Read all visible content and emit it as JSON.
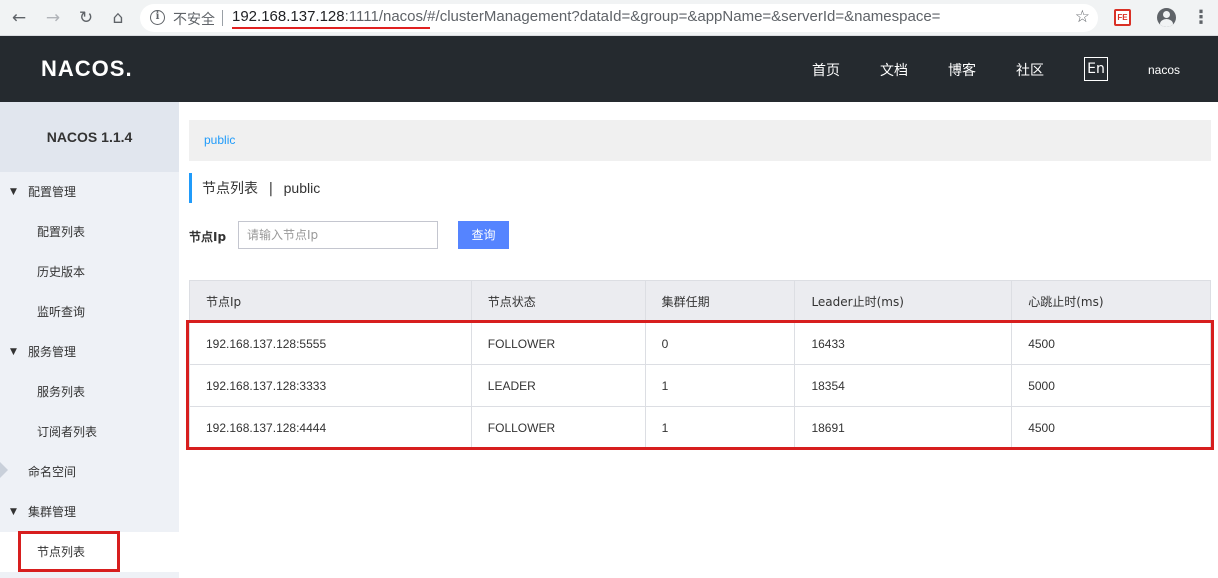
{
  "browser": {
    "insecure_label": "不安全",
    "url_host": "192.168.137.128",
    "url_rest": ":1111/nacos/#/clusterManagement?dataId=&group=&appName=&serverId=&namespace=",
    "ext_label": "FE"
  },
  "header": {
    "logo": "NACOS.",
    "nav": [
      "首页",
      "文档",
      "博客",
      "社区"
    ],
    "lang": "En",
    "user": "nacos"
  },
  "sidebar": {
    "version": "NACOS 1.1.4",
    "groups": [
      {
        "label": "配置管理",
        "items": [
          "配置列表",
          "历史版本",
          "监听查询"
        ]
      },
      {
        "label": "服务管理",
        "items": [
          "服务列表",
          "订阅者列表"
        ]
      },
      {
        "label": "命名空间"
      },
      {
        "label": "集群管理",
        "items": [
          "节点列表"
        ]
      }
    ]
  },
  "main": {
    "breadcrumb": "public",
    "title": "节点列表",
    "title_sep": "|",
    "namespace": "public",
    "filter_label": "节点Ip",
    "filter_placeholder": "请输入节点Ip",
    "query_label": "查询",
    "table": {
      "headers": [
        "节点Ip",
        "节点状态",
        "集群任期",
        "Leader止时(ms)",
        "心跳止时(ms)"
      ],
      "rows": [
        [
          "192.168.137.128:5555",
          "FOLLOWER",
          "0",
          "16433",
          "4500"
        ],
        [
          "192.168.137.128:3333",
          "LEADER",
          "1",
          "18354",
          "5000"
        ],
        [
          "192.168.137.128:4444",
          "FOLLOWER",
          "1",
          "18691",
          "4500"
        ]
      ]
    }
  },
  "colors": {
    "accent": "#209bfa",
    "button": "#5584ff",
    "header_bg": "#252a2f",
    "highlight": "#d71e1e"
  }
}
